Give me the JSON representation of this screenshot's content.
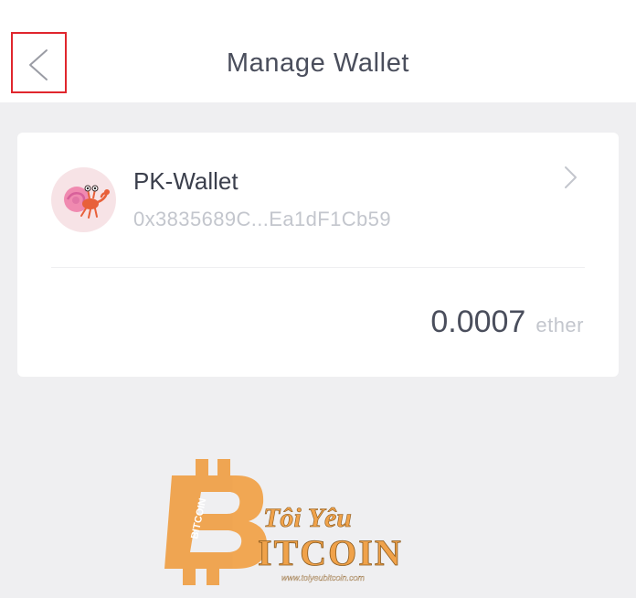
{
  "header": {
    "title": "Manage Wallet"
  },
  "wallet": {
    "name": "PK-Wallet",
    "address": "0x3835689C...Ea1dF1Cb59",
    "balance": "0.0007",
    "unit": "ether"
  },
  "watermark": {
    "line1": "Tôi Yêu",
    "line2": "ITCOIN",
    "coin_text": "BITCOIN",
    "url": "www.toiyeubitcoin.com"
  },
  "colors": {
    "highlight": "#e0262d",
    "watermark_orange": "#f0a24a",
    "text_dark": "#4a4e5c",
    "text_muted": "#c3c6cd"
  }
}
